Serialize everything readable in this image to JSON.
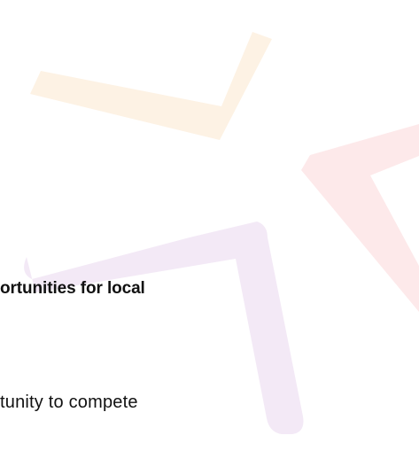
{
  "content": {
    "heading_fragment": "ortunities for local",
    "body_fragment": "tunity to compete"
  },
  "decoration": {
    "shapes": [
      "orange-chevron",
      "red-chevron",
      "purple-chevron"
    ],
    "colors": {
      "orange": "#fdf2e4",
      "red": "#fde9ea",
      "purple": "#f3e9f6"
    }
  }
}
